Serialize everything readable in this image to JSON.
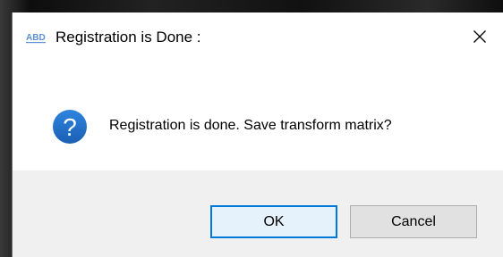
{
  "window": {
    "title": "Registration is Done :",
    "app_icon": "abd-app-logo-icon",
    "close_icon": "close-icon"
  },
  "dialog": {
    "icon": "question-icon",
    "icon_glyph": "?",
    "icon_color": "#1f6fc5",
    "message": "Registration is done. Save transform matrix?"
  },
  "buttons": {
    "ok_label": "OK",
    "cancel_label": "Cancel",
    "focus_color": "#0078d7"
  }
}
